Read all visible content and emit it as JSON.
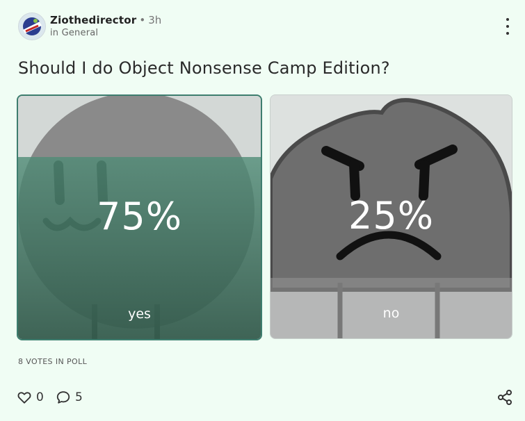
{
  "post": {
    "author": "Ziothedirector",
    "separator": "•",
    "time": "3h",
    "category": "in General"
  },
  "poll": {
    "question": "Should I do Object Nonsense Camp Edition?",
    "options": [
      {
        "label": "yes",
        "percent_text": "75%",
        "percent": 75,
        "selected": true
      },
      {
        "label": "no",
        "percent_text": "25%",
        "percent": 25,
        "selected": false
      }
    ],
    "votes_text": "8 VOTES IN POLL"
  },
  "actions": {
    "likes": "0",
    "comments": "5"
  },
  "icons": [
    "more-options-icon",
    "heart-icon",
    "comment-icon",
    "share-icon"
  ],
  "colors": {
    "background": "#f0fdf4",
    "selected_accent": "#3d7d6e"
  }
}
